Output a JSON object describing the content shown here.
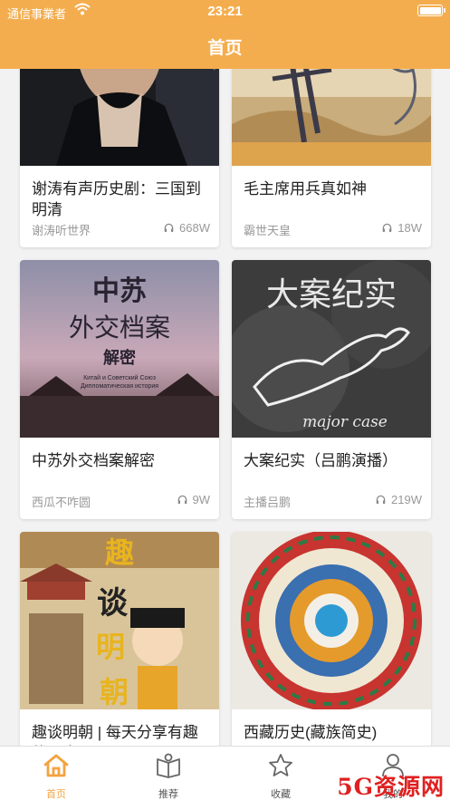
{
  "status_bar": {
    "carrier": "通信事業者",
    "time": "23:21"
  },
  "header": {
    "title": "首页"
  },
  "cards": [
    {
      "title": "谢涛有声历史剧：三国到明清",
      "author": "谢涛听世界",
      "plays": "668W"
    },
    {
      "title": "毛主席用兵真如神",
      "author": "霸世天皇",
      "plays": "18W"
    },
    {
      "title": "中苏外交档案解密",
      "author": "西瓜不咋圆",
      "plays": "9W",
      "cover_text": {
        "line1": "中苏",
        "line2": "外交档案",
        "line3": "解密",
        "line4": "Китай и Советский Союз",
        "line5": "Дипломатическая история"
      }
    },
    {
      "title": "大案纪实（吕鹏演播）",
      "author": "主播吕鹏",
      "plays": "219W",
      "cover_text": {
        "line1": "大案纪实",
        "line2": "major case"
      }
    },
    {
      "title": "趣谈明朝 | 每天分享有趣的历史",
      "author": "",
      "plays": "",
      "cover_text": {
        "c1": "趣",
        "c2": "谈",
        "c3": "明",
        "c4": "朝"
      }
    },
    {
      "title": "西藏历史(藏族简史)",
      "author": "",
      "plays": ""
    }
  ],
  "tabs": [
    {
      "label": "首页",
      "icon": "home-icon",
      "active": true
    },
    {
      "label": "推荐",
      "icon": "book-icon",
      "active": false
    },
    {
      "label": "收藏",
      "icon": "star-icon",
      "active": false
    },
    {
      "label": "我的",
      "icon": "user-icon",
      "active": false
    }
  ],
  "watermark": "5G资源网",
  "colors": {
    "accent": "#f4ad4e",
    "tab_active": "#f4a340",
    "text_secondary": "#999999"
  }
}
